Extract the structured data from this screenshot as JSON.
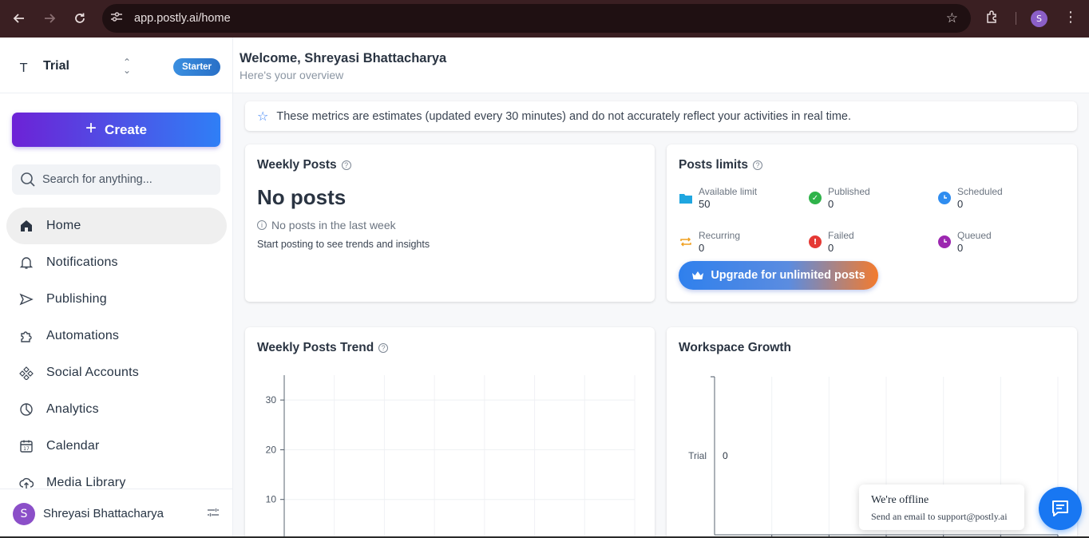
{
  "browser": {
    "url": "app.postly.ai/home",
    "profile_initial": "S",
    "icons": [
      "back-arrow-icon",
      "forward-arrow-icon",
      "reload-icon",
      "site-settings-icon",
      "bookmark-star-icon",
      "extensions-icon",
      "more-menu-icon"
    ]
  },
  "workspace": {
    "letter": "T",
    "name": "Trial",
    "plan": "Starter"
  },
  "sidebar": {
    "create_label": "Create",
    "search_placeholder": "Search for anything...",
    "items": [
      {
        "label": "Home",
        "icon": "home-icon",
        "active": true
      },
      {
        "label": "Notifications",
        "icon": "bell-icon"
      },
      {
        "label": "Publishing",
        "icon": "send-icon"
      },
      {
        "label": "Automations",
        "icon": "puzzle-icon"
      },
      {
        "label": "Social Accounts",
        "icon": "network-icon"
      },
      {
        "label": "Analytics",
        "icon": "pie-chart-icon"
      },
      {
        "label": "Calendar",
        "icon": "calendar-icon"
      },
      {
        "label": "Media Library",
        "icon": "cloud-upload-icon"
      }
    ],
    "user": {
      "initial": "S",
      "name": "Shreyasi Bhattacharya"
    }
  },
  "header": {
    "welcome": "Welcome, Shreyasi Bhattacharya",
    "subtitle": "Here's your overview"
  },
  "notice": "These metrics are estimates (updated every 30 minutes) and do not accurately reflect your activities in real time.",
  "weekly_posts": {
    "title": "Weekly Posts",
    "headline": "No posts",
    "status": "No posts in the last week",
    "hint": "Start posting to see trends and insights"
  },
  "posts_limits": {
    "title": "Posts limits",
    "items": [
      {
        "label": "Available limit",
        "value": "50",
        "icon": "folder-icon",
        "color": "#1fa6e0"
      },
      {
        "label": "Published",
        "value": "0",
        "icon": "check-circle-icon",
        "color": "#2fb34a"
      },
      {
        "label": "Scheduled",
        "value": "0",
        "icon": "clock-icon",
        "color": "#2f8df0"
      },
      {
        "label": "Recurring",
        "value": "0",
        "icon": "repeat-icon",
        "color": "#f0a020"
      },
      {
        "label": "Failed",
        "value": "0",
        "icon": "alert-icon",
        "color": "#e53935"
      },
      {
        "label": "Queued",
        "value": "0",
        "icon": "queue-clock-icon",
        "color": "#9c27b0"
      }
    ],
    "upgrade_label": "Upgrade for unlimited posts"
  },
  "weekly_trend": {
    "title": "Weekly Posts Trend"
  },
  "workspace_growth": {
    "title": "Workspace Growth"
  },
  "chart_data": [
    {
      "type": "line",
      "title": "Weekly Posts Trend",
      "y_ticks": [
        30,
        20,
        10
      ],
      "ylim": [
        0,
        35
      ],
      "grid": true,
      "series": []
    },
    {
      "type": "bar",
      "title": "Workspace Growth",
      "categories": [
        "Trial"
      ],
      "values": [
        0
      ],
      "orientation": "horizontal",
      "grid": true
    }
  ],
  "chat": {
    "title": "We're offline",
    "subtitle": "Send an email to support@postly.ai"
  }
}
